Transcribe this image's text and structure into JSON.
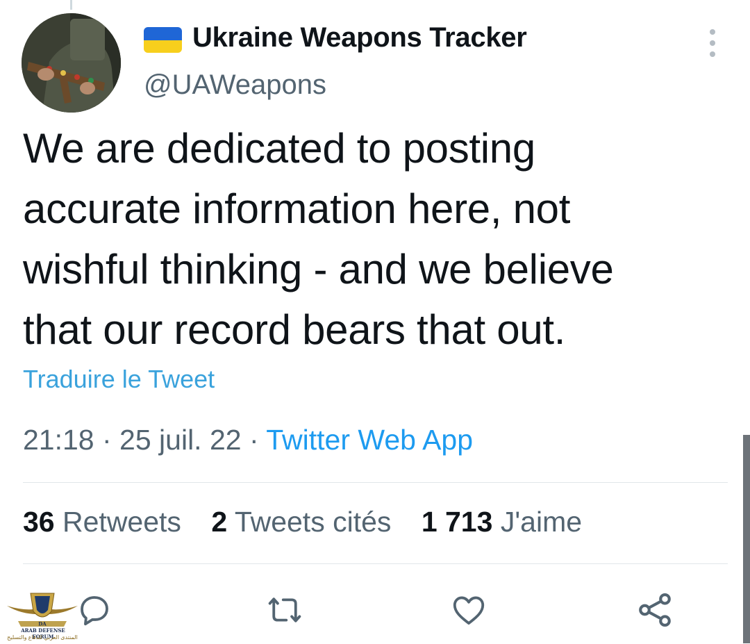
{
  "tweet": {
    "author": {
      "name": "Ukraine Weapons Tracker",
      "handle": "@UAWeapons",
      "flag_colors": {
        "top": "#1f66d6",
        "bottom": "#f7cf1d"
      }
    },
    "text_lines": [
      "We are dedicated to posting",
      "accurate information here, not",
      "wishful thinking - and we believe",
      "that our record bears that out."
    ],
    "translate_label": "Traduire le Tweet",
    "time": "21:18",
    "separator": " · ",
    "date": "25 juil. 22",
    "source": "Twitter Web App",
    "stats": {
      "retweets": {
        "count": "36",
        "label": "Retweets"
      },
      "quotes": {
        "count": "2",
        "label": "Tweets cités"
      },
      "likes": {
        "count": "1 713",
        "label": "J'aime"
      }
    },
    "actions": [
      "reply-icon",
      "retweet-icon",
      "like-icon",
      "share-icon"
    ]
  },
  "watermark": {
    "brand": "DA",
    "name": "ARAB DEFENSE FORUM",
    "name_ar": "المنتدى العربي للدفاع والتسليح"
  },
  "colors": {
    "text": "#0f1419",
    "secondary": "#536471",
    "link": "#1d9bf0",
    "icon": "#536471"
  }
}
